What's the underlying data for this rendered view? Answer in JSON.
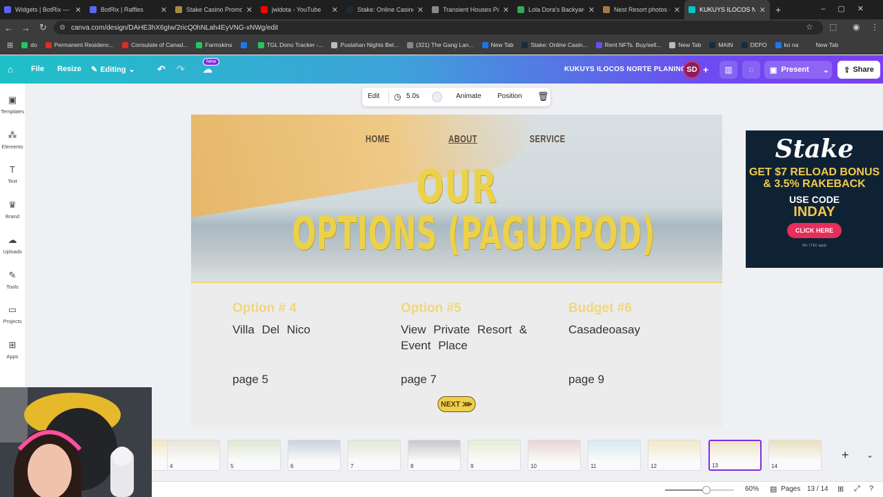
{
  "browser": {
    "tabs": [
      {
        "title": "Widgets | BotRix — C",
        "color": "#5865f2"
      },
      {
        "title": "BotRix | Raffles",
        "color": "#5865f2"
      },
      {
        "title": "Stake Casino Promo",
        "color": "#aa8844"
      },
      {
        "title": "jwldota - YouTube",
        "color": "#ff0000"
      },
      {
        "title": "Stake: Online Casino",
        "color": "#1a2c38"
      },
      {
        "title": "Transient Houses Pa",
        "color": "#888888"
      },
      {
        "title": "Lola Dora's Backyard",
        "color": "#34a853"
      },
      {
        "title": "Nest Resort photos -",
        "color": "#aa7744"
      },
      {
        "title": "KUKUYS ILOCOS NOR",
        "color": "#00c4cc"
      }
    ],
    "url": "canva.com/design/DAHE3hX6gIw/2ricQ0hNLah4EyVNG-xNWg/edit",
    "bookmarks": [
      {
        "label": "do",
        "color": "#22c55e"
      },
      {
        "label": "Permanent Residenc...",
        "color": "#d93025"
      },
      {
        "label": "Consulate of Canad...",
        "color": "#d93025"
      },
      {
        "label": "Farmskins",
        "color": "#22c55e"
      },
      {
        "label": "",
        "color": "#1877f2"
      },
      {
        "label": "TGL Dono Tracker -...",
        "color": "#22c55e"
      },
      {
        "label": "Pustahan Nights Bet...",
        "color": "#bbbbbb"
      },
      {
        "label": "(321) The Gang Lan...",
        "color": "#888888"
      },
      {
        "label": "New Tab",
        "color": "#1a73e8"
      },
      {
        "label": "Stake: Online Casin...",
        "color": "#1a2c38"
      },
      {
        "label": "Rent NFTs. Buy/sell...",
        "color": "#6d4bf0"
      },
      {
        "label": "New Tab",
        "color": "#bbbbbb"
      },
      {
        "label": "MAIN",
        "color": "#1a2c38"
      },
      {
        "label": "DEPO",
        "color": "#1a2c38"
      },
      {
        "label": "ko na",
        "color": "#1877f2"
      },
      {
        "label": "New Tab",
        "color": "#3c3c3c"
      }
    ]
  },
  "toolbar": {
    "file": "File",
    "resize": "Resize",
    "editing": "Editing",
    "new_badge": "New",
    "project_title": "KUKUYS ILOCOS NORTE PLANING",
    "avatar": "SD",
    "present": "Present",
    "share": "Share"
  },
  "sidebar": {
    "items": [
      {
        "label": "Templates",
        "icon": "templates-icon"
      },
      {
        "label": "Elements",
        "icon": "elements-icon"
      },
      {
        "label": "Text",
        "icon": "text-icon"
      },
      {
        "label": "Brand",
        "icon": "brand-icon"
      },
      {
        "label": "Uploads",
        "icon": "uploads-icon"
      },
      {
        "label": "Tools",
        "icon": "tools-icon"
      },
      {
        "label": "Projects",
        "icon": "projects-icon"
      },
      {
        "label": "Apps",
        "icon": "apps-icon"
      }
    ]
  },
  "context_toolbar": {
    "edit": "Edit",
    "duration": "5.0s",
    "animate": "Animate",
    "position": "Position"
  },
  "slide": {
    "nav": [
      "HOME",
      "ABOUT",
      "SERVICE"
    ],
    "title_line1": "OUR",
    "title_line2": "OPTIONS (PAGUDPOD)",
    "options": [
      {
        "heading": "Option # 4",
        "name": "Villa Del Nico",
        "page": "page 5"
      },
      {
        "heading": "Option #5",
        "name": "View  Private  Resort & Event Place",
        "page": "page 7"
      },
      {
        "heading": "Budget #6",
        "name": "Casadeoasay",
        "page": "page 9"
      }
    ],
    "next_button": "NEXT ⋙"
  },
  "ad": {
    "logo": "Stake",
    "line1": "GET $7 RELOAD BONUS & 3.5% RAKEBACK",
    "line2": "USE CODE",
    "code": "INDAY",
    "cta": "CLICK HERE",
    "fine": "18+ | T&C apply"
  },
  "pages": {
    "thumbnails": [
      {
        "number": "",
        "color": "#f3e6c2"
      },
      {
        "number": "4",
        "color": "#e8e4d8"
      },
      {
        "number": "5",
        "color": "#dfe8d4"
      },
      {
        "number": "6",
        "color": "#c9d2de"
      },
      {
        "number": "7",
        "color": "#e4e8d8"
      },
      {
        "number": "8",
        "color": "#c8c8c8"
      },
      {
        "number": "9",
        "color": "#e6ecd6"
      },
      {
        "number": "10",
        "color": "#e8d4d4"
      },
      {
        "number": "11",
        "color": "#d6eaf0"
      },
      {
        "number": "12",
        "color": "#f1e8c6"
      },
      {
        "number": "13",
        "color": "#ede3c4"
      },
      {
        "number": "14",
        "color": "#e8e0c0"
      }
    ]
  },
  "status": {
    "zoom": "60%",
    "zoom_fraction": 0.6,
    "pages_label": "Pages",
    "page_count": "13 / 14"
  }
}
